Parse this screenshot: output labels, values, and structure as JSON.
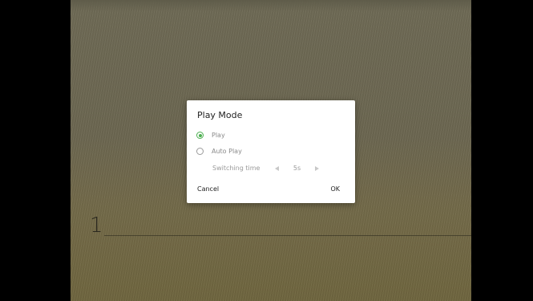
{
  "background": {
    "page_number": "1"
  },
  "dialog": {
    "title": "Play Mode",
    "options": [
      {
        "label": "Play",
        "selected": true
      },
      {
        "label": "Auto Play",
        "selected": false
      }
    ],
    "switching_time": {
      "label": "Switching time",
      "value": "5s"
    },
    "cancel_label": "Cancel",
    "ok_label": "OK"
  },
  "colors": {
    "accent": "#4caf50",
    "dialog_bg": "#ffffff"
  }
}
